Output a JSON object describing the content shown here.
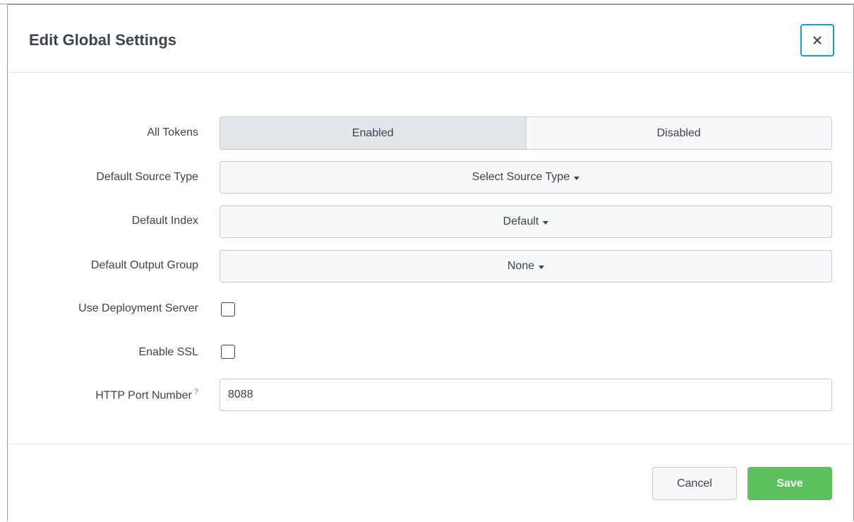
{
  "modal": {
    "title": "Edit Global Settings",
    "close_icon": "close-icon"
  },
  "form": {
    "all_tokens": {
      "label": "All Tokens",
      "options": [
        "Enabled",
        "Disabled"
      ],
      "selected": "Enabled"
    },
    "source_type": {
      "label": "Default Source Type",
      "value": "Select Source Type"
    },
    "index": {
      "label": "Default Index",
      "value": "Default"
    },
    "output_group": {
      "label": "Default Output Group",
      "value": "None"
    },
    "deployment_server": {
      "label": "Use Deployment Server",
      "checked": false
    },
    "ssl": {
      "label": "Enable SSL",
      "checked": false
    },
    "http_port": {
      "label": "HTTP Port Number",
      "help": "?",
      "value": "8088"
    }
  },
  "footer": {
    "cancel_label": "Cancel",
    "save_label": "Save"
  },
  "colors": {
    "accent": "#1a9cd8",
    "save": "#5cc05c"
  }
}
